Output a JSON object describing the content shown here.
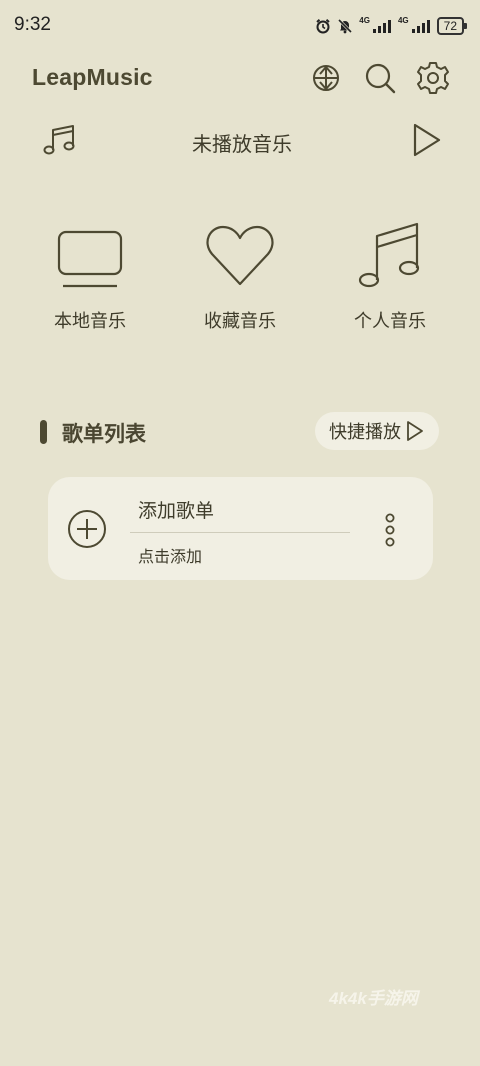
{
  "status_bar": {
    "time": "9:32",
    "network_1": "4G",
    "network_2": "4G",
    "battery": "72"
  },
  "header": {
    "app_title": "LeapMusic",
    "icons": [
      "swap-vertical-icon",
      "search-icon",
      "gear-icon"
    ]
  },
  "now_playing": {
    "title": "未播放音乐"
  },
  "shortcuts": [
    {
      "label": "本地音乐",
      "icon": "monitor-icon"
    },
    {
      "label": "收藏音乐",
      "icon": "heart-icon"
    },
    {
      "label": "个人音乐",
      "icon": "music-note-icon"
    }
  ],
  "playlist_section": {
    "title": "歌单列表",
    "quick_play_label": "快捷播放"
  },
  "playlist_card": {
    "title": "添加歌单",
    "subtitle": "点击添加"
  },
  "watermark": "4k4k手游网",
  "colors": {
    "background": "#e6e3cf",
    "card": "#f1efe3",
    "accent": "#4d4932"
  }
}
